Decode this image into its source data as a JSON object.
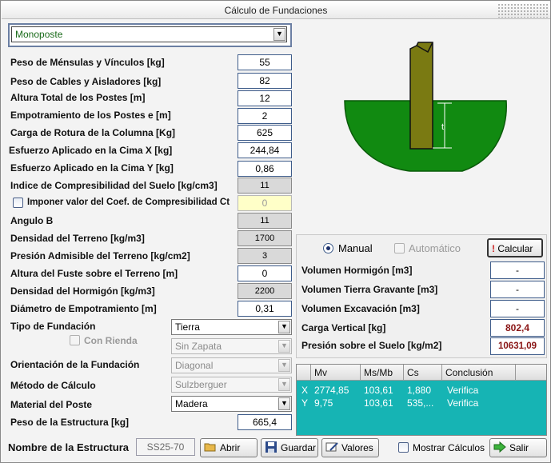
{
  "window": {
    "title": "Cálculo de Fundaciones"
  },
  "structure_type": {
    "selected": "Monoposte"
  },
  "params": [
    {
      "label": "Peso de Ménsulas y Vínculos  [kg]",
      "value": "55"
    },
    {
      "label": "Peso de Cables y Aisladores [kg]",
      "value": "82"
    },
    {
      "label": "Altura Total de los Postes [m]",
      "value": "12"
    },
    {
      "label": "Empotramiento de los Postes e [m]",
      "value": "2"
    },
    {
      "label": "Carga de Rotura de la Columna [Kg]",
      "value": "625"
    },
    {
      "label": "Esfuerzo Aplicado en la Cima X [kg]",
      "value": "244,84"
    },
    {
      "label": "Esfuerzo Aplicado en la Cima Y [kg]",
      "value": "0,86"
    },
    {
      "label": "Indice de Compresibilidad del Suelo [kg/cm3]",
      "value": "11"
    },
    {
      "label": "Imponer valor del Coef. de Compresibilidad Ct",
      "value": "0"
    },
    {
      "label": "Angulo B",
      "value": "11"
    },
    {
      "label": "Densidad del Terreno [kg/m3]",
      "value": "1700"
    },
    {
      "label": "Presión Admisible del Terreno [kg/cm2]",
      "value": "3"
    },
    {
      "label": "Altura del Fuste sobre el Terreno [m]",
      "value": "0"
    },
    {
      "label": "Densidad del Hormigón [kg/m3]",
      "value": "2200"
    },
    {
      "label": "Diámetro de Empotramiento [m]",
      "value": "0,31"
    }
  ],
  "selects": {
    "tipo_fundacion": {
      "label": "Tipo de Fundación",
      "value": "Tierra"
    },
    "con_rienda": {
      "label": "Con Rienda",
      "value": "Sin Zapata"
    },
    "orientacion": {
      "label": "Orientación de la Fundación",
      "value": "Diagonal"
    },
    "metodo": {
      "label": "Método de Cálculo",
      "value": "Sulzberguer"
    },
    "material": {
      "label": "Material del Poste",
      "value": "Madera"
    }
  },
  "peso_estructura": {
    "label": "Peso de la Estructura [kg]",
    "value": "665,4"
  },
  "drawing": {
    "depth_label": "t"
  },
  "calc": {
    "manual_label": "Manual",
    "auto_label": "Automático",
    "calc_button": "Calcular",
    "results": [
      {
        "label": "Volumen Hormigón [m3]",
        "value": "-"
      },
      {
        "label": "Volumen Tierra Gravante [m3]",
        "value": "-"
      },
      {
        "label": "Volumen Excavación [m3]",
        "value": "-"
      },
      {
        "label": "Carga Vertical [kg]",
        "value": "802,4"
      },
      {
        "label": "Presión sobre el Suelo [kg/m2]",
        "value": "10631,09"
      }
    ]
  },
  "table": {
    "headers": [
      "Mv",
      "Ms/Mb",
      "Cs",
      "Conclusión"
    ],
    "rows": [
      {
        "axis": "X",
        "mv": "2774,85",
        "msmb": "103,61",
        "cs": "1,880",
        "conclusion": "Verifica"
      },
      {
        "axis": "Y",
        "mv": "9,75",
        "msmb": "103,61",
        "cs": "535,...",
        "conclusion": "Verifica"
      }
    ]
  },
  "footer": {
    "name_label": "Nombre de la Estructura",
    "name_value": "SS25-70",
    "open": "Abrir",
    "save": "Guardar",
    "values": "Valores",
    "show_calcs": "Mostrar Cálculos",
    "exit": "Salir"
  },
  "colors": {
    "soil": "#118a11",
    "pole": "#7a7a12",
    "grid": "#16b4b4",
    "accent": "#3e5c8a"
  }
}
